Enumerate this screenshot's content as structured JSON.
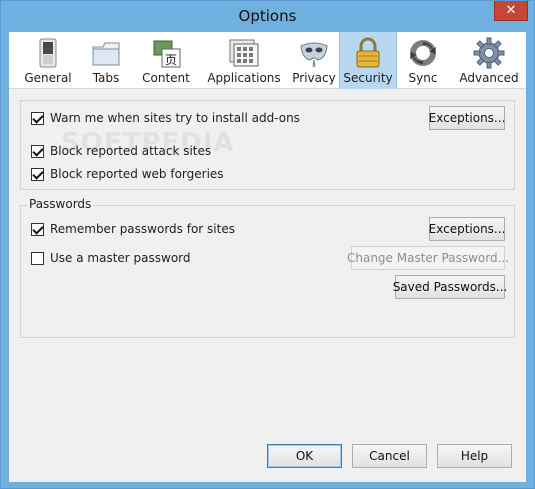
{
  "window": {
    "title": "Options",
    "close_glyph": "✕"
  },
  "tabs": [
    {
      "label": "General",
      "icon": "switch-icon"
    },
    {
      "label": "Tabs",
      "icon": "tabs-icon"
    },
    {
      "label": "Content",
      "icon": "content-icon"
    },
    {
      "label": "Applications",
      "icon": "applications-icon"
    },
    {
      "label": "Privacy",
      "icon": "mask-icon"
    },
    {
      "label": "Security",
      "icon": "lock-icon"
    },
    {
      "label": "Sync",
      "icon": "sync-icon"
    },
    {
      "label": "Advanced",
      "icon": "gear-icon"
    }
  ],
  "selected_tab": "Security",
  "addons": {
    "warn_label": "Warn me when sites try to install add-ons",
    "warn_checked": true,
    "exceptions_label": "Exceptions...",
    "block_attack_label": "Block reported attack sites",
    "block_attack_checked": true,
    "block_forgeries_label": "Block reported web forgeries",
    "block_forgeries_checked": true
  },
  "passwords": {
    "legend": "Passwords",
    "remember_label": "Remember passwords for sites",
    "remember_checked": true,
    "exceptions_label": "Exceptions...",
    "master_label": "Use a master password",
    "master_checked": false,
    "change_master_label": "Change Master Password...",
    "saved_label": "Saved Passwords..."
  },
  "footer": {
    "ok": "OK",
    "cancel": "Cancel",
    "help": "Help"
  },
  "watermark": "SOFTPEDIA",
  "colors": {
    "titlebar": "#6fb0e0",
    "selected_tab": "#b8d7f0",
    "close": "#c7463c"
  }
}
